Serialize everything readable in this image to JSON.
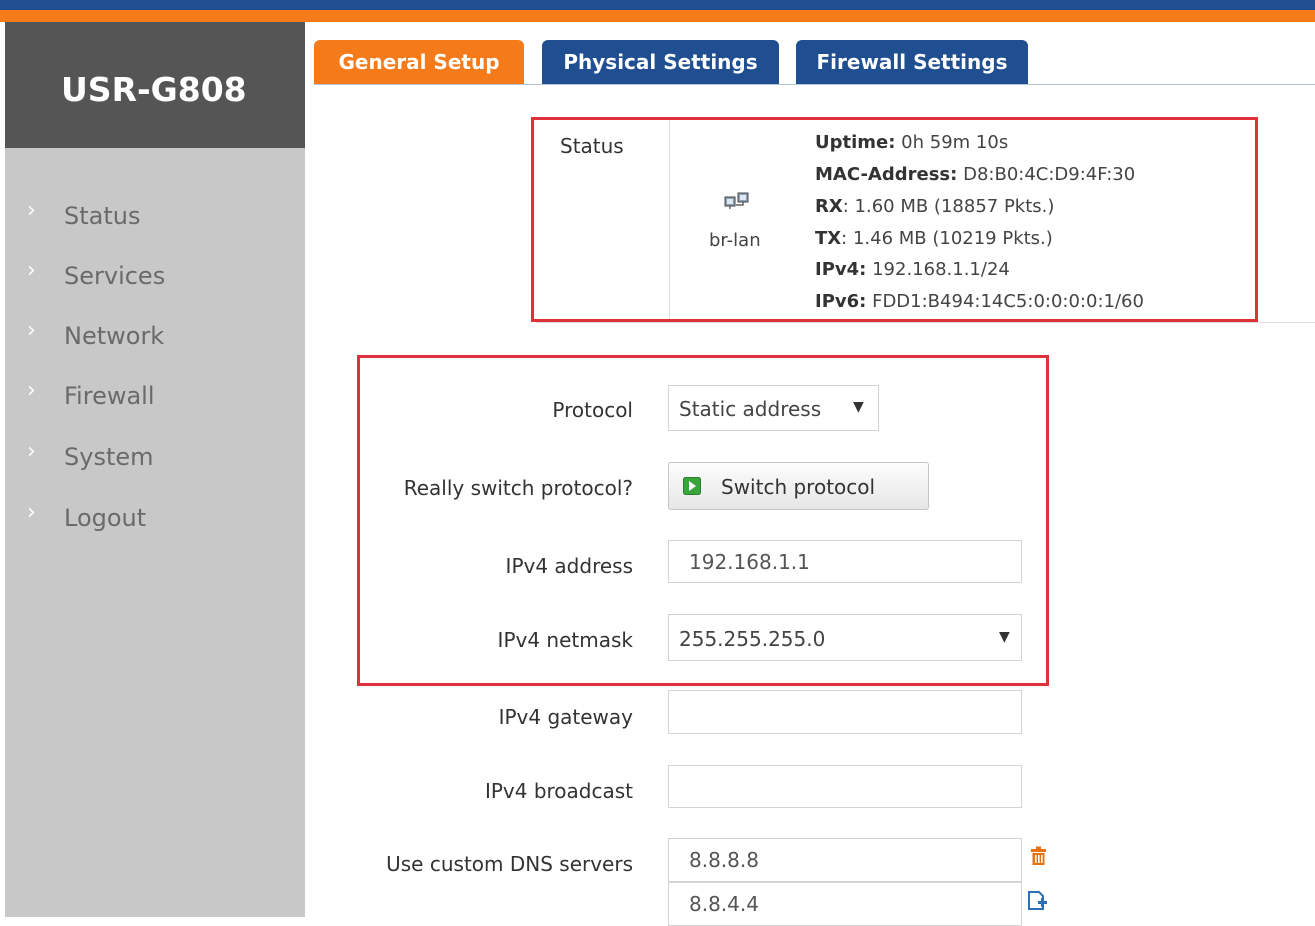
{
  "brand": "USR-G808",
  "sidebar": {
    "items": [
      {
        "label": "Status"
      },
      {
        "label": "Services"
      },
      {
        "label": "Network"
      },
      {
        "label": "Firewall"
      },
      {
        "label": "System"
      },
      {
        "label": "Logout"
      }
    ]
  },
  "tabs": [
    {
      "label": "General Setup",
      "active": true
    },
    {
      "label": "Physical Settings",
      "active": false
    },
    {
      "label": "Firewall Settings",
      "active": false
    }
  ],
  "status": {
    "label": "Status",
    "interface": "br-lan",
    "uptime_key": "Uptime:",
    "uptime": "0h 59m 10s",
    "mac_key": "MAC-Address:",
    "mac": "D8:B0:4C:D9:4F:30",
    "rx_key": "RX",
    "rx": ": 1.60 MB (18857 Pkts.)",
    "tx_key": "TX",
    "tx": ": 1.46 MB (10219 Pkts.)",
    "ipv4_key": "IPv4:",
    "ipv4": "192.168.1.1/24",
    "ipv6_key": "IPv6:",
    "ipv6": "FDD1:B494:14C5:0:0:0:0:1/60"
  },
  "form": {
    "protocol_label": "Protocol",
    "protocol_value": "Static address",
    "switch_label": "Really switch protocol?",
    "switch_button": "Switch protocol",
    "ipv4_address_label": "IPv4 address",
    "ipv4_address_value": "192.168.1.1",
    "ipv4_netmask_label": "IPv4 netmask",
    "ipv4_netmask_value": "255.255.255.0",
    "ipv4_gateway_label": "IPv4 gateway",
    "ipv4_gateway_value": "",
    "ipv4_broadcast_label": "IPv4 broadcast",
    "ipv4_broadcast_value": "",
    "dns_label": "Use custom DNS servers",
    "dns_values": [
      "8.8.8.8",
      "8.8.4.4"
    ]
  },
  "colors": {
    "accent_orange": "#f47a1a",
    "accent_blue": "#1f4e91",
    "highlight_red": "#e0303b"
  }
}
